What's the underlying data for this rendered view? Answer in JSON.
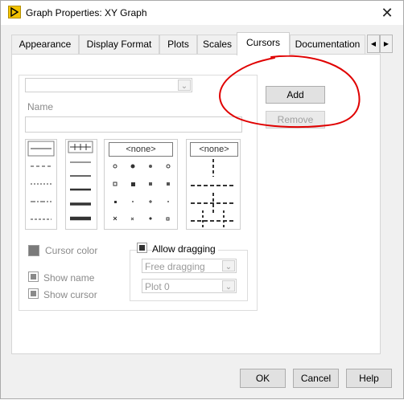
{
  "window": {
    "title": "Graph Properties: XY Graph"
  },
  "tabs": [
    {
      "label": "Appearance"
    },
    {
      "label": "Display Format"
    },
    {
      "label": "Plots"
    },
    {
      "label": "Scales"
    },
    {
      "label": "Cursors",
      "active": true
    },
    {
      "label": "Documentation"
    }
  ],
  "cursors": {
    "cursor_select": {
      "value": ""
    },
    "name_label": "Name",
    "name_value": "",
    "add_label": "Add",
    "remove_label": "Remove",
    "point_style_none": "<none>",
    "line_style_none": "<none>",
    "cursor_color_label": "Cursor color",
    "show_name_label": "Show name",
    "show_cursor_label": "Show cursor",
    "allow_dragging_label": "Allow dragging",
    "dragging_mode": "Free dragging",
    "plot_select": "Plot 0"
  },
  "footer": {
    "ok_label": "OK",
    "cancel_label": "Cancel",
    "help_label": "Help"
  },
  "annotation": {
    "color": "#e00000"
  }
}
